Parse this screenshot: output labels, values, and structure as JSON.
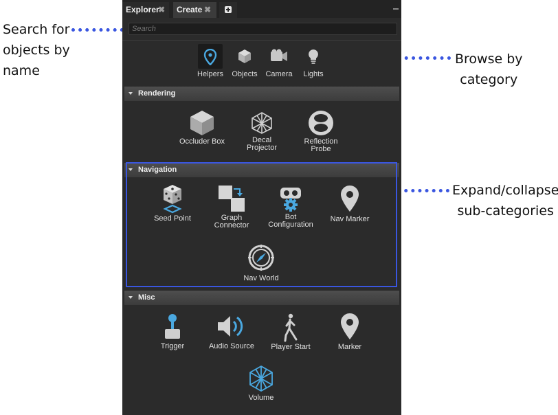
{
  "tabs": [
    {
      "label": "Explorer",
      "close": "✖"
    },
    {
      "label": "Create",
      "close": "✖"
    }
  ],
  "search": {
    "placeholder": "Search"
  },
  "categories": [
    {
      "label": "Helpers",
      "icon": "location-pin-icon",
      "selected": true
    },
    {
      "label": "Objects",
      "icon": "cube-icon"
    },
    {
      "label": "Camera",
      "icon": "camera-icon"
    },
    {
      "label": "Lights",
      "icon": "lightbulb-icon"
    }
  ],
  "sections": [
    {
      "title": "Rendering",
      "items": [
        {
          "label": "Occluder Box",
          "icon": "box-icon"
        },
        {
          "label": "Decal\nProjector",
          "icon": "wire-cube-icon"
        },
        {
          "label": "Reflection\nProbe",
          "icon": "probe-sphere-icon"
        }
      ]
    },
    {
      "title": "Navigation",
      "items": [
        {
          "label": "Seed Point",
          "icon": "dice-icon"
        },
        {
          "label": "Graph\nConnector",
          "icon": "graph-connector-icon"
        },
        {
          "label": "Bot\nConfiguration",
          "icon": "bot-gear-icon"
        },
        {
          "label": "Nav Marker",
          "icon": "map-pin-icon"
        },
        {
          "label": "Nav World",
          "icon": "compass-icon"
        }
      ]
    },
    {
      "title": "Misc",
      "items": [
        {
          "label": "Trigger",
          "icon": "joystick-icon"
        },
        {
          "label": "Audio Source",
          "icon": "speaker-icon"
        },
        {
          "label": "Player Start",
          "icon": "walking-person-icon"
        },
        {
          "label": "Marker",
          "icon": "map-pin-icon"
        },
        {
          "label": "Volume",
          "icon": "volume-mesh-icon"
        }
      ]
    }
  ],
  "callouts": {
    "search": "Search for\nobjects by\nname",
    "browse": "Browse by\ncategory",
    "expand": "Expand/collapse\nsub-categories"
  },
  "colors": {
    "accent": "#3a56e0",
    "panel": "#2b2b2b",
    "icon_blue": "#4aa8e0"
  }
}
